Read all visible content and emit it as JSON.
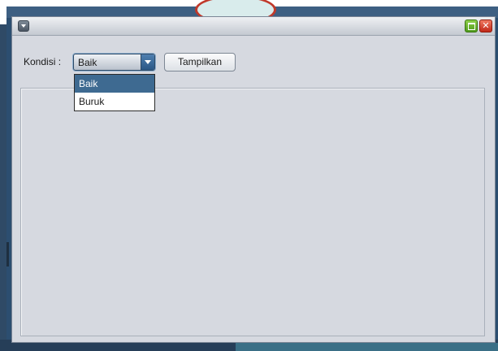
{
  "window": {
    "close_glyph": "✕"
  },
  "form": {
    "kondisi_label": "Kondisi :",
    "combo_selected": "Baik",
    "combo_options": [
      "Baik",
      "Buruk"
    ],
    "show_button_label": "Tampilkan"
  },
  "icons": {
    "system_menu": "chevron-down-icon",
    "maximize": "maximize-icon",
    "close": "close-icon",
    "combo_arrow": "chevron-down-icon"
  },
  "colors": {
    "selection": "#3e6a91",
    "window_bg": "#d6d9e0",
    "close": "#d13a24",
    "maximize": "#6cb531"
  }
}
